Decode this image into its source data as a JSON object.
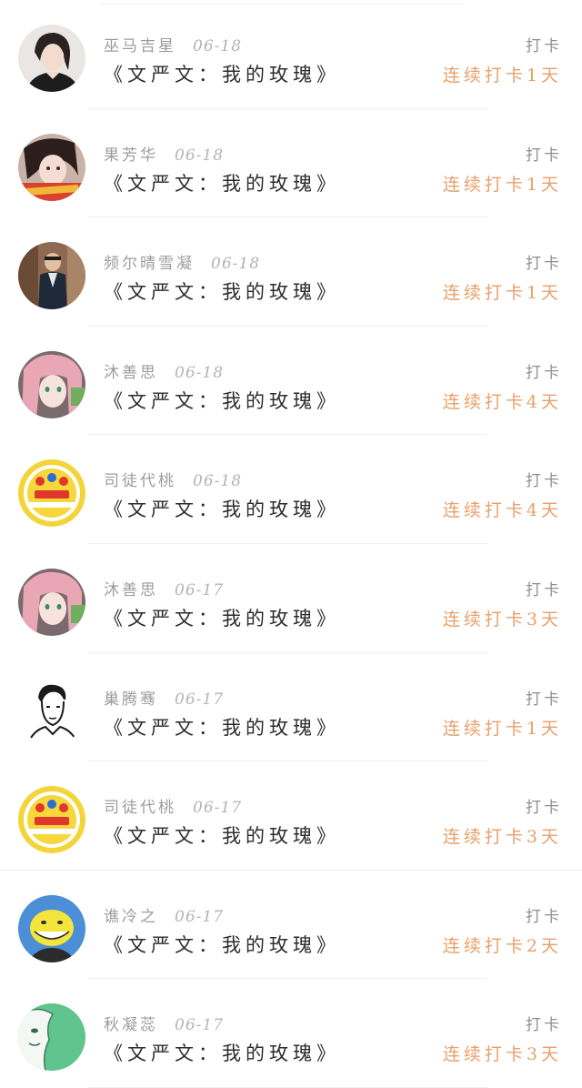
{
  "colors": {
    "streak": "#e8a06a",
    "meta": "#9c9c9c",
    "title": "#2c2c2c",
    "divider": "#f0f0f0"
  },
  "entries": [
    {
      "username": "巫马吉星",
      "date": "06-18",
      "title": "《文严文：我的玫瑰》",
      "action": "打卡",
      "streak": "连续打卡1天",
      "avatar": "girl-photo-avatar"
    },
    {
      "username": "果芳华",
      "date": "06-18",
      "title": "《文严文：我的玫瑰》",
      "action": "打卡",
      "streak": "连续打卡1天",
      "avatar": "girl-selfie-avatar"
    },
    {
      "username": "频尔晴雪凝",
      "date": "06-18",
      "title": "《文严文：我的玫瑰》",
      "action": "打卡",
      "streak": "连续打卡1天",
      "avatar": "man-photo-avatar"
    },
    {
      "username": "沐善思",
      "date": "06-18",
      "title": "《文严文：我的玫瑰》",
      "action": "打卡",
      "streak": "连续打卡4天",
      "avatar": "anime-girl-avatar"
    },
    {
      "username": "司徒代桃",
      "date": "06-18",
      "title": "《文严文：我的玫瑰》",
      "action": "打卡",
      "streak": "连续打卡4天",
      "avatar": "tnt-logo-avatar"
    },
    {
      "username": "沐善思",
      "date": "06-17",
      "title": "《文严文：我的玫瑰》",
      "action": "打卡",
      "streak": "连续打卡3天",
      "avatar": "anime-girl-avatar"
    },
    {
      "username": "巢腾骞",
      "date": "06-17",
      "title": "《文严文：我的玫瑰》",
      "action": "打卡",
      "streak": "连续打卡1天",
      "avatar": "sketch-man-avatar"
    },
    {
      "username": "司徒代桃",
      "date": "06-17",
      "title": "《文严文：我的玫瑰》",
      "action": "打卡",
      "streak": "连续打卡3天",
      "avatar": "tnt-logo-avatar"
    },
    {
      "username": "谯冷之",
      "date": "06-17",
      "title": "《文严文：我的玫瑰》",
      "action": "打卡",
      "streak": "连续打卡2天",
      "avatar": "yellow-face-avatar"
    },
    {
      "username": "秋凝蕊",
      "date": "06-17",
      "title": "《文严文：我的玫瑰》",
      "action": "打卡",
      "streak": "连续打卡3天",
      "avatar": "ghost-green-avatar"
    }
  ]
}
